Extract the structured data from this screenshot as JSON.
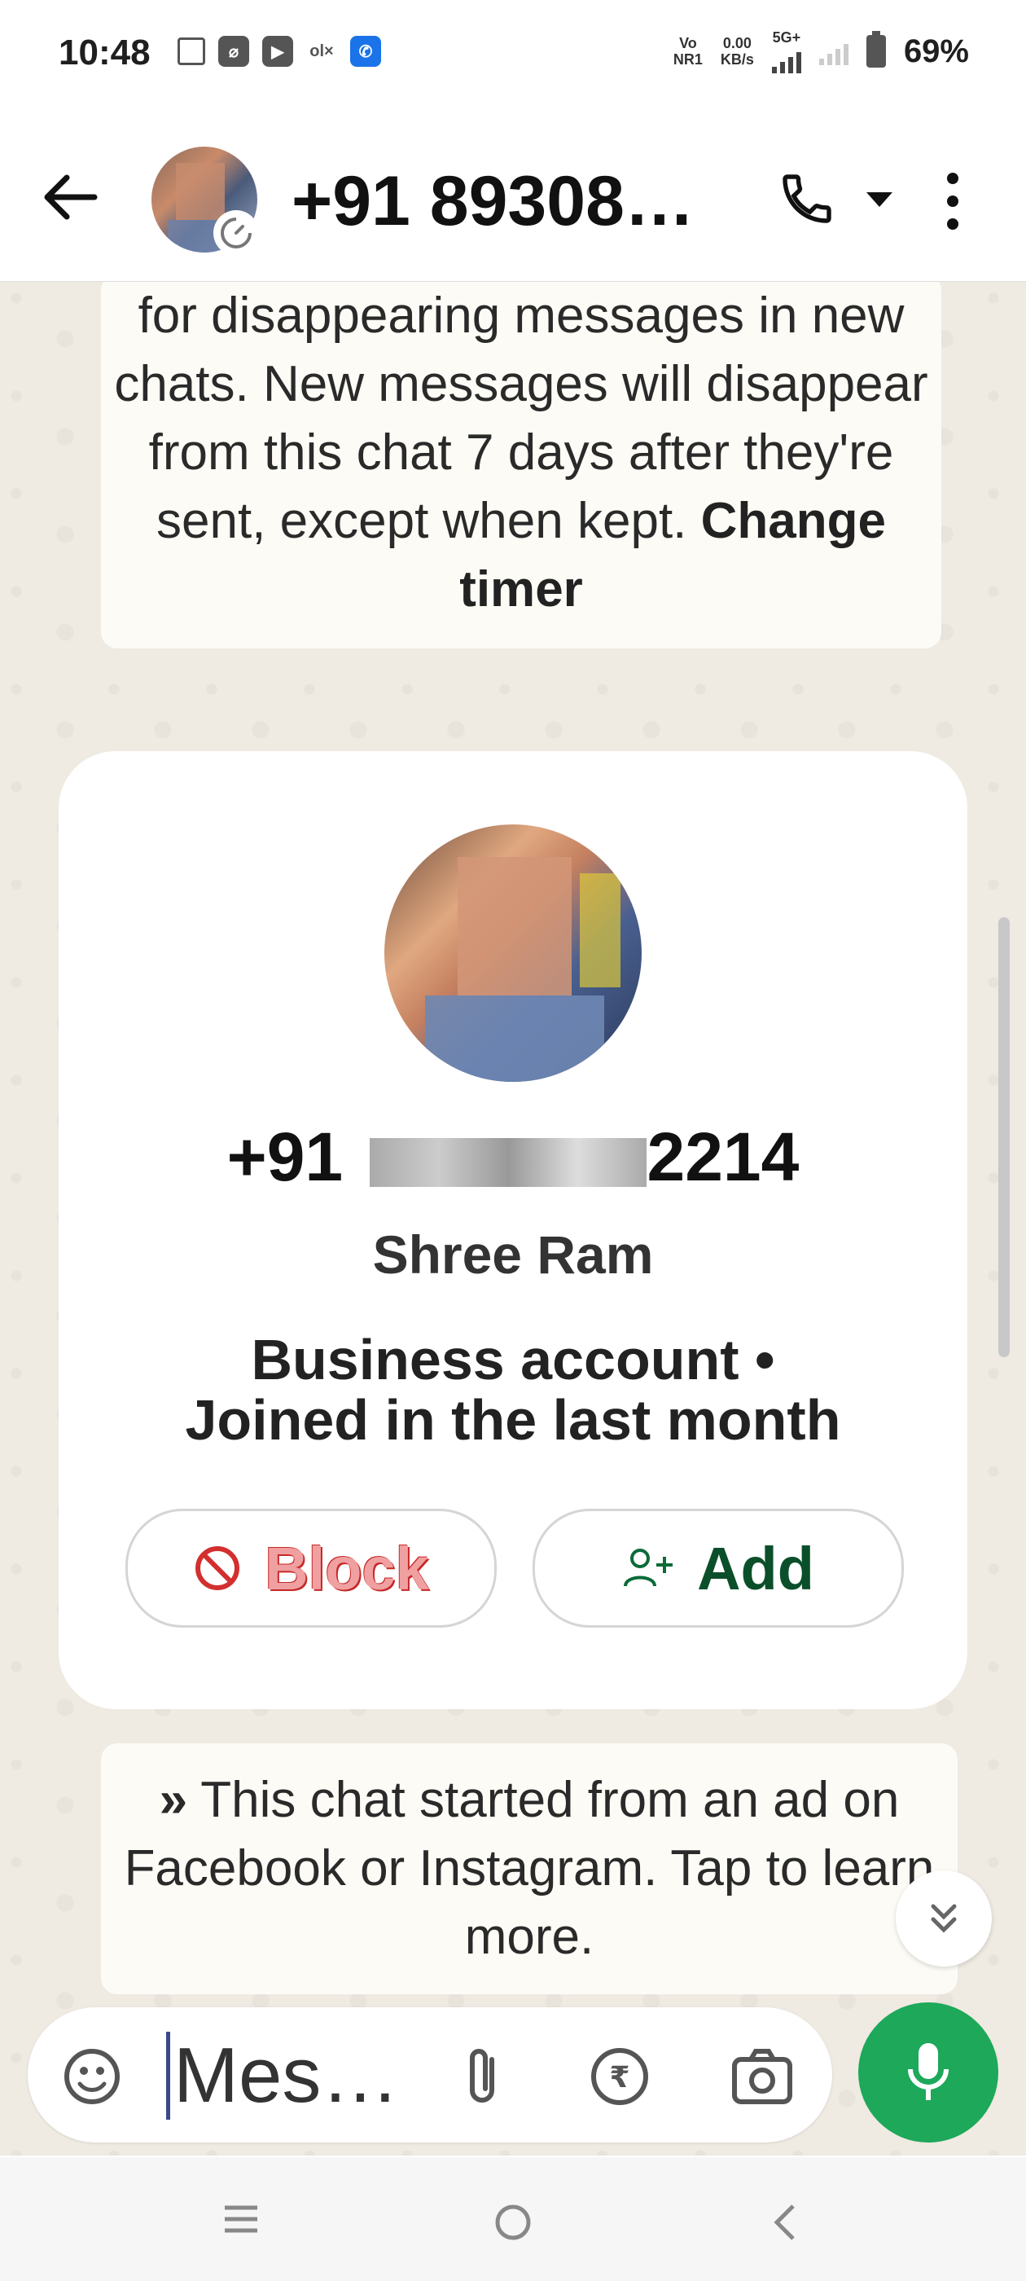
{
  "status_bar": {
    "time": "10:48",
    "net_top": "Vo",
    "net_bottom": "NR1",
    "speed_top": "0.00",
    "speed_bottom": "KB/s",
    "gen": "5G+",
    "battery": "69%"
  },
  "header": {
    "title": "+91 89308…",
    "icons": [
      "back-arrow-icon",
      "contact-avatar",
      "timer-icon",
      "phone-icon",
      "dropdown-icon",
      "more-vert-icon"
    ]
  },
  "messages": {
    "disappearing_text": "for disappearing messages in new chats. New messages will disappear from this chat 7 days after they're sent, except when kept.",
    "disappearing_link": "Change timer",
    "ad_text": "This chat started from an ad on Facebook or Instagram. Tap to learn more."
  },
  "contact_card": {
    "phone_prefix": "+91",
    "phone_suffix": "2214",
    "name": "Shree Ram",
    "business_line1": "Business account •",
    "business_line2": "Joined in the last month",
    "block_label": "Block",
    "add_label": "Add"
  },
  "composer": {
    "placeholder": "Mes…"
  },
  "colors": {
    "accent": "#1da85a",
    "chat_bg": "#efeae2",
    "block_red": "#c62828",
    "add_green": "#0b4f2a"
  }
}
